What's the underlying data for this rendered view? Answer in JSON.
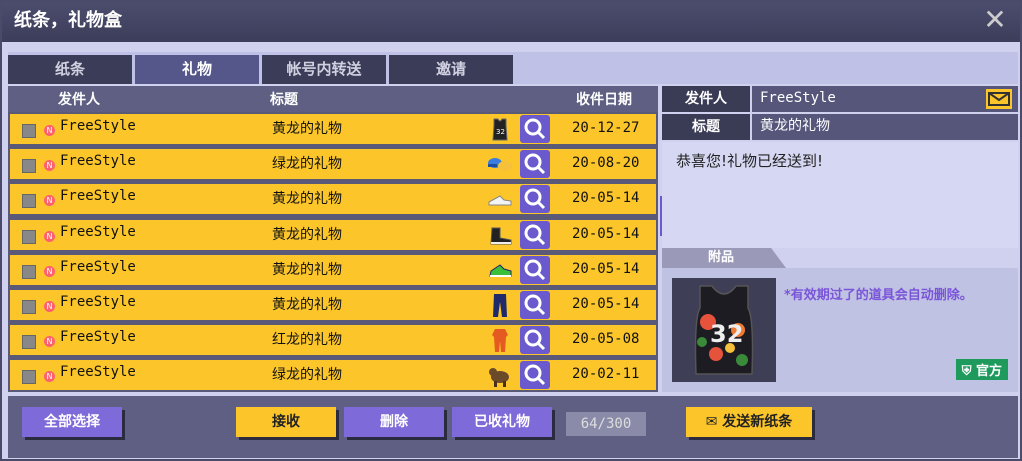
{
  "window": {
    "title": "纸条，礼物盒",
    "close_glyph": "✕"
  },
  "tabs": [
    {
      "label": "纸条",
      "active": false
    },
    {
      "label": "礼物",
      "active": true
    },
    {
      "label": "帐号内转送",
      "active": false
    },
    {
      "label": "邀请",
      "active": false
    }
  ],
  "list": {
    "headers": {
      "sender": "发件人",
      "subject": "标题",
      "date": "收件日期"
    },
    "rows": [
      {
        "sender": "FreeStyle",
        "subject": "黄龙的礼物",
        "item_icon": "jersey-icon",
        "date": "20-12-27"
      },
      {
        "sender": "FreeStyle",
        "subject": "绿龙的礼物",
        "item_icon": "caps-icon",
        "date": "20-08-20"
      },
      {
        "sender": "FreeStyle",
        "subject": "黄龙的礼物",
        "item_icon": "sneakers-icon",
        "date": "20-05-14"
      },
      {
        "sender": "FreeStyle",
        "subject": "黄龙的礼物",
        "item_icon": "shoe-icon",
        "date": "20-05-14"
      },
      {
        "sender": "FreeStyle",
        "subject": "黄龙的礼物",
        "item_icon": "shoe-green-icon",
        "date": "20-05-14"
      },
      {
        "sender": "FreeStyle",
        "subject": "黄龙的礼物",
        "item_icon": "pants-icon",
        "date": "20-05-14"
      },
      {
        "sender": "FreeStyle",
        "subject": "红龙的礼物",
        "item_icon": "jumpsuit-icon",
        "date": "20-05-08"
      },
      {
        "sender": "FreeStyle",
        "subject": "绿龙的礼物",
        "item_icon": "pet-icon",
        "date": "20-02-11"
      }
    ]
  },
  "detail": {
    "sender_label": "发件人",
    "sender_value": "FreeStyle",
    "subject_label": "标题",
    "subject_value": "黄龙的礼物",
    "message": "恭喜您!礼物已经送到!",
    "attachment_label": "附品",
    "expiry_note": "*有效期过了的道具会自动删除。",
    "official_badge": "官方"
  },
  "footer": {
    "select_all": "全部选择",
    "receive": "接收",
    "delete": "删除",
    "received_gifts": "已收礼物",
    "counter": "64/300",
    "send_new": "发送新纸条"
  },
  "colors": {
    "row_bg": "#fcc62a",
    "accent": "#6a5acd",
    "official": "#1e9a5c"
  }
}
